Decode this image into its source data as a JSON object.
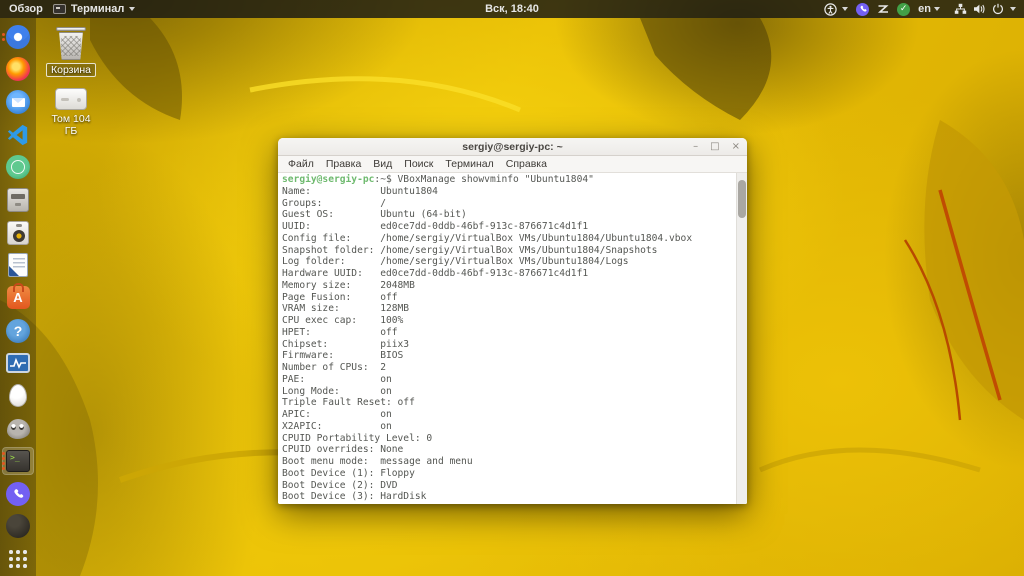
{
  "top_bar": {
    "activities_label": "Обзор",
    "app_menu_label": "Терминал",
    "clock": "Вск, 18:40",
    "keyboard_layout": "en",
    "tray_check_glyph": "✓",
    "icons": [
      "accessibility-icon",
      "viber-tray-icon",
      "zigzag-status-icon",
      "updates-ok-icon",
      "network-wired-icon",
      "volume-icon",
      "power-icon"
    ]
  },
  "desktop_icons": {
    "trash_label": "Корзина",
    "volume_label": "Том 104 ГБ"
  },
  "dock": {
    "items": [
      "chromium",
      "firefox",
      "thunderbird",
      "vscode",
      "green-app",
      "file-cabinet",
      "audio-player",
      "libreoffice-writer",
      "ubuntu-software",
      "help",
      "system-monitor",
      "egg-app",
      "gimp",
      "terminal",
      "viber",
      "dark-app",
      "show-applications"
    ],
    "active_item": "terminal",
    "terminal_glyph": ">_",
    "help_glyph": "?",
    "software_glyph": "A"
  },
  "window": {
    "title": "sergiy@sergiy-pc: ~",
    "controls": {
      "minimize": "–",
      "maximize": "□",
      "close": "×"
    },
    "menu_items": [
      "Файл",
      "Правка",
      "Вид",
      "Поиск",
      "Терминал",
      "Справка"
    ],
    "terminal": {
      "prompt_user": "sergiy@sergiy-pc",
      "prompt_suffix": ":~$ ",
      "command": "VBoxManage showvminfo \"Ubuntu1804\"",
      "output_lines": [
        "Name:            Ubuntu1804",
        "Groups:          /",
        "Guest OS:        Ubuntu (64-bit)",
        "UUID:            ed0ce7dd-0ddb-46bf-913c-876671c4d1f1",
        "Config file:     /home/sergiy/VirtualBox VMs/Ubuntu1804/Ubuntu1804.vbox",
        "Snapshot folder: /home/sergiy/VirtualBox VMs/Ubuntu1804/Snapshots",
        "Log folder:      /home/sergiy/VirtualBox VMs/Ubuntu1804/Logs",
        "Hardware UUID:   ed0ce7dd-0ddb-46bf-913c-876671c4d1f1",
        "Memory size:     2048MB",
        "Page Fusion:     off",
        "VRAM size:       128MB",
        "CPU exec cap:    100%",
        "HPET:            off",
        "Chipset:         piix3",
        "Firmware:        BIOS",
        "Number of CPUs:  2",
        "PAE:             on",
        "Long Mode:       on",
        "Triple Fault Reset: off",
        "APIC:            on",
        "X2APIC:          on",
        "CPUID Portability Level: 0",
        "CPUID overrides: None",
        "Boot menu mode:  message and menu",
        "Boot Device (1): Floppy",
        "Boot Device (2): DVD",
        "Boot Device (3): HardDisk"
      ]
    }
  },
  "colors": {
    "prompt_green": "#6fba6f",
    "terminal_text": "#555753",
    "terminal_bg": "#ffffff",
    "topbar_bg": "#171714",
    "accent_orange": "#e2571f",
    "wallpaper_yellow": "#e8be05"
  }
}
